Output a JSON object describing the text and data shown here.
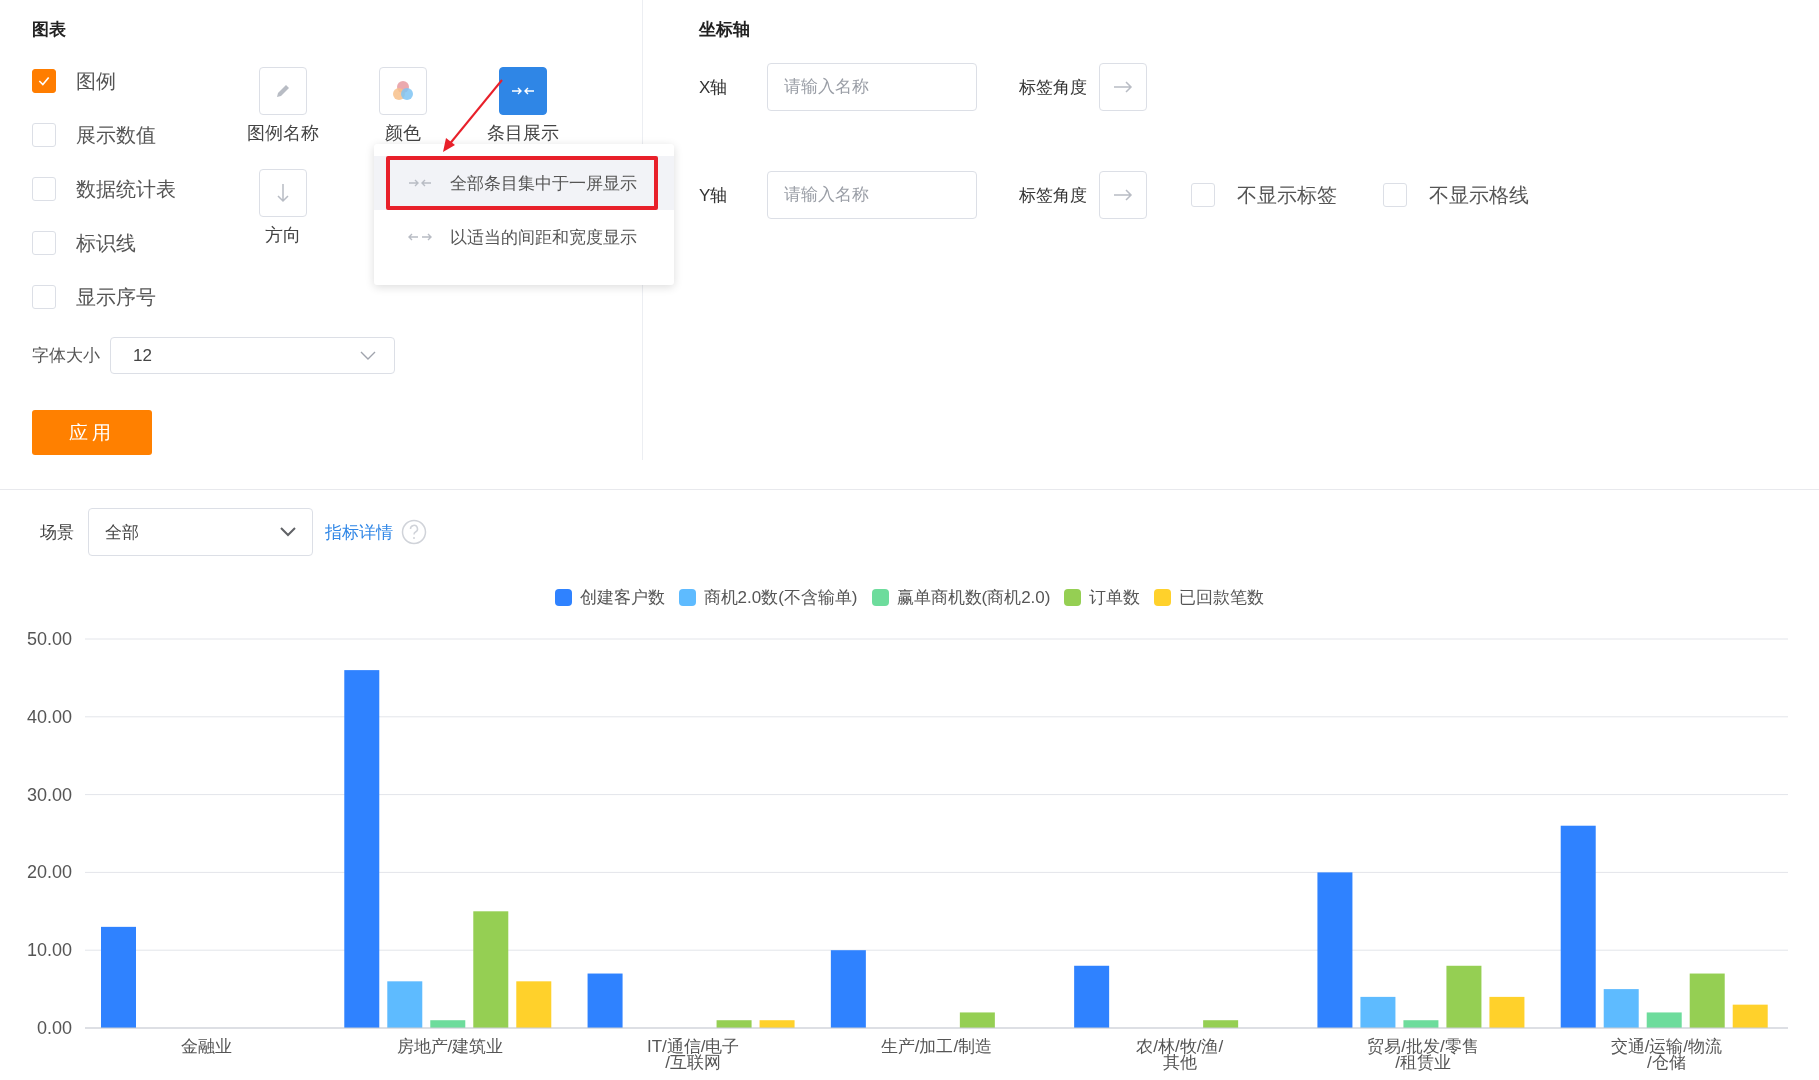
{
  "chart_settings": {
    "title": "图表",
    "options": [
      {
        "label": "图例",
        "checked": true
      },
      {
        "label": "展示数值",
        "checked": false
      },
      {
        "label": "数据统计表",
        "checked": false
      },
      {
        "label": "标识线",
        "checked": false
      },
      {
        "label": "显示序号",
        "checked": false
      }
    ],
    "tools": [
      {
        "kind": "pencil",
        "label": "图例名称",
        "selected": false
      },
      {
        "kind": "colors",
        "label": "颜色",
        "selected": false
      },
      {
        "kind": "collapse",
        "label": "条目展示",
        "selected": true
      },
      {
        "kind": "direction",
        "label": "方向",
        "selected": false
      }
    ],
    "font_size": {
      "label": "字体大小",
      "value": "12"
    },
    "apply_button": "应用"
  },
  "display_menu": {
    "items": [
      {
        "kind": "collapse",
        "label": "全部条目集中于一屏显示",
        "selected": true
      },
      {
        "kind": "expand",
        "label": "以适当的间距和宽度显示",
        "selected": false
      }
    ]
  },
  "axis_settings": {
    "title": "坐标轴",
    "axes": [
      {
        "label": "X轴",
        "placeholder": "请输入名称",
        "angle_label": "标签角度"
      },
      {
        "label": "Y轴",
        "placeholder": "请输入名称",
        "angle_label": "标签角度",
        "options": [
          {
            "label": "不显示标签",
            "checked": false
          },
          {
            "label": "不显示格线",
            "checked": false
          }
        ]
      }
    ]
  },
  "filter": {
    "label": "场景",
    "value": "全部",
    "link": "指标详情"
  },
  "chart_data": {
    "type": "bar",
    "categories": [
      "金融业",
      "房地产/建筑业",
      "IT/通信/电子\n/互联网",
      "生产/加工/制造",
      "农/林/牧/渔/\n其他",
      "贸易/批发/零售\n/租赁业",
      "交通/运输/物流\n/仓储"
    ],
    "series": [
      {
        "name": "创建客户数",
        "color": "#2f82ff",
        "values": [
          13,
          46,
          7,
          10,
          8,
          20,
          26
        ]
      },
      {
        "name": "商机2.0数(不含输单)",
        "color": "#5ebbff",
        "values": [
          0,
          6,
          0,
          0,
          0,
          4,
          5
        ]
      },
      {
        "name": "赢单商机数(商机2.0)",
        "color": "#6ddc9c",
        "values": [
          0,
          1,
          0,
          0,
          0,
          1,
          2
        ]
      },
      {
        "name": "订单数",
        "color": "#95cf53",
        "values": [
          0,
          15,
          1,
          2,
          1,
          8,
          7
        ]
      },
      {
        "name": "已回款笔数",
        "color": "#ffd12b",
        "values": [
          0,
          6,
          1,
          0,
          0,
          4,
          3
        ]
      }
    ],
    "ylim": [
      0,
      50
    ],
    "grid": true,
    "yticks": [
      {
        "value": 0,
        "label": "0.00"
      },
      {
        "value": 10,
        "label": "10.00"
      },
      {
        "value": 20,
        "label": "20.00"
      },
      {
        "value": 30,
        "label": "30.00"
      },
      {
        "value": 40,
        "label": "40.00"
      },
      {
        "value": 50,
        "label": "50.00"
      }
    ]
  }
}
